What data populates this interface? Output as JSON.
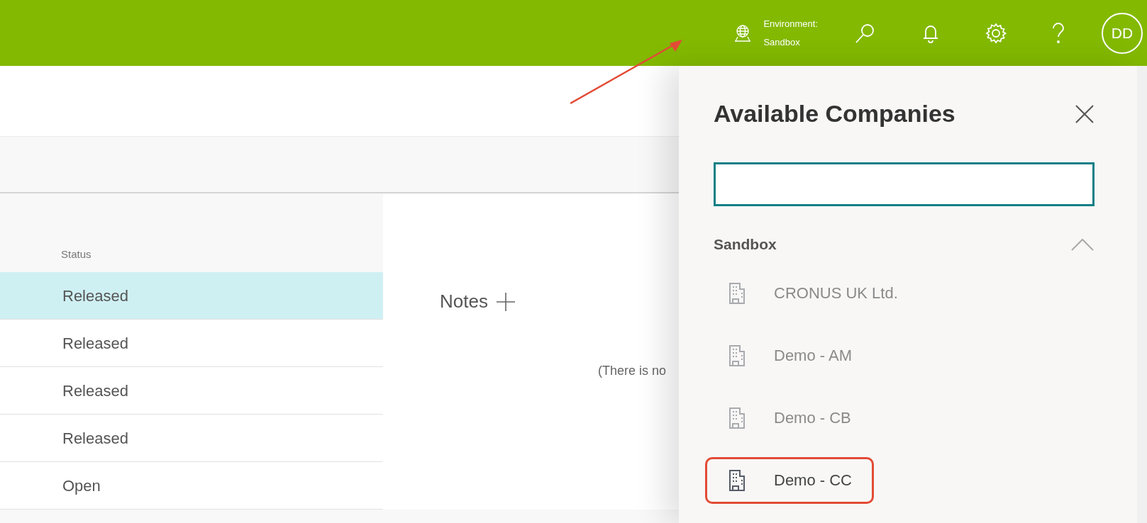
{
  "top_bar": {
    "environment_label": "Environment:",
    "environment_name": "Sandbox",
    "avatar": "DD"
  },
  "table": {
    "columns": [
      "Status"
    ],
    "rows": [
      {
        "status": "Released",
        "selected": true
      },
      {
        "status": "Released",
        "selected": false
      },
      {
        "status": "Released",
        "selected": false
      },
      {
        "status": "Released",
        "selected": false
      },
      {
        "status": "Open",
        "selected": false
      }
    ]
  },
  "notes": {
    "title": "Notes",
    "empty_text": "(There is no"
  },
  "companies_panel": {
    "title": "Available Companies",
    "group": {
      "name": "Sandbox",
      "expanded": true,
      "items": [
        {
          "name": "CRONUS UK Ltd.",
          "current": false,
          "highlighted": false
        },
        {
          "name": "Demo - AM",
          "current": false,
          "highlighted": false
        },
        {
          "name": "Demo - CB",
          "current": false,
          "highlighted": false
        },
        {
          "name": "Demo - CC",
          "current": true,
          "highlighted": true
        }
      ]
    }
  }
}
